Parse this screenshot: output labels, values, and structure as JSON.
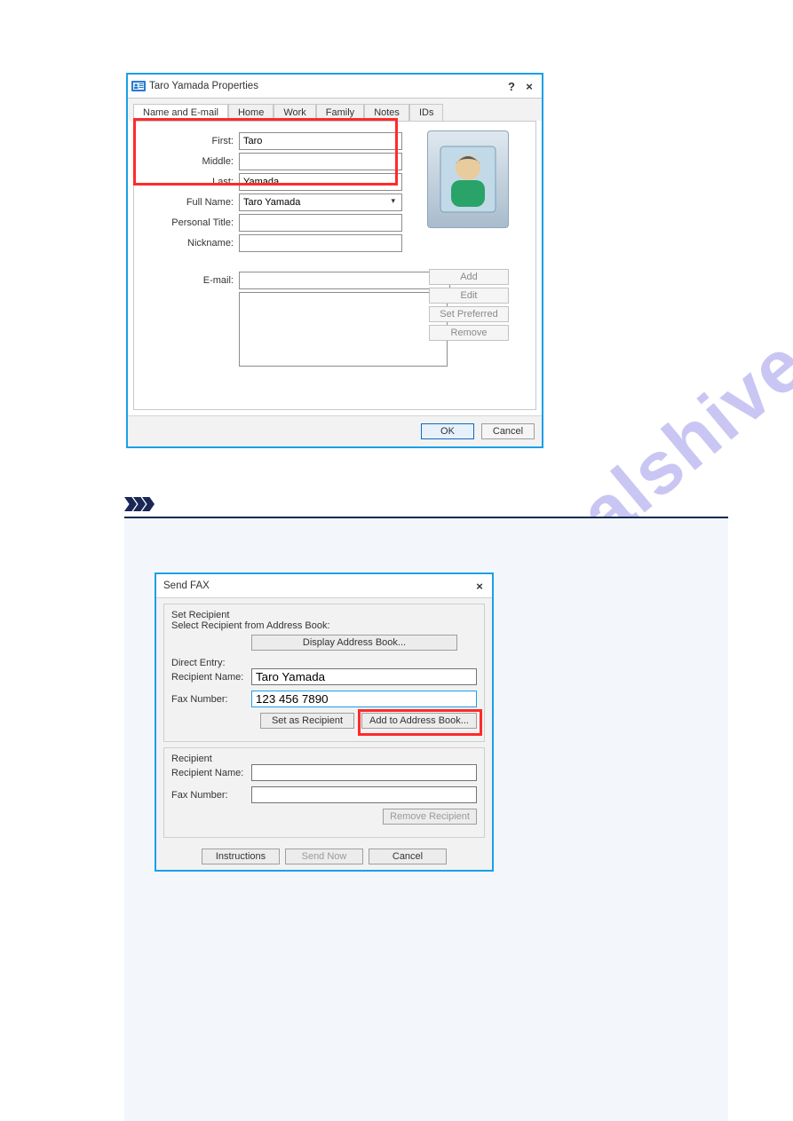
{
  "watermark": "manualshive.com",
  "dlg1": {
    "title": "Taro Yamada Properties",
    "help": "?",
    "close": "×",
    "tabs": [
      "Name and E-mail",
      "Home",
      "Work",
      "Family",
      "Notes",
      "IDs"
    ],
    "labels": {
      "first": "First:",
      "middle": "Middle:",
      "last": "Last:",
      "fullname": "Full Name:",
      "ptitle": "Personal Title:",
      "nick": "Nickname:",
      "email": "E-mail:"
    },
    "values": {
      "first": "Taro",
      "middle": "",
      "last": "Yamada",
      "fullname": "Taro Yamada",
      "ptitle": "",
      "nick": "",
      "email": ""
    },
    "sidebtns": {
      "add": "Add",
      "edit": "Edit",
      "pref": "Set Preferred",
      "remove": "Remove"
    },
    "footer": {
      "ok": "OK",
      "cancel": "Cancel"
    }
  },
  "dlg2": {
    "title": "Send FAX",
    "close": "×",
    "set_rcpt_hdr": "Set Recipient",
    "select_hdr": "Select Recipient from Address Book:",
    "display_btn": "Display Address Book...",
    "direct_entry": "Direct Entry:",
    "rname_lbl": "Recipient Name:",
    "fax_lbl": "Fax Number:",
    "rname_val": "Taro Yamada",
    "fax_val": "123 456 7890",
    "set_as_rcpt": "Set as Recipient",
    "add_ab": "Add to Address Book...",
    "rcpt_hdr": "Recipient",
    "rname2_lbl": "Recipient Name:",
    "fax2_lbl": "Fax Number:",
    "remove_rcpt": "Remove Recipient",
    "footer": {
      "instr": "Instructions",
      "send": "Send Now",
      "cancel": "Cancel"
    }
  }
}
